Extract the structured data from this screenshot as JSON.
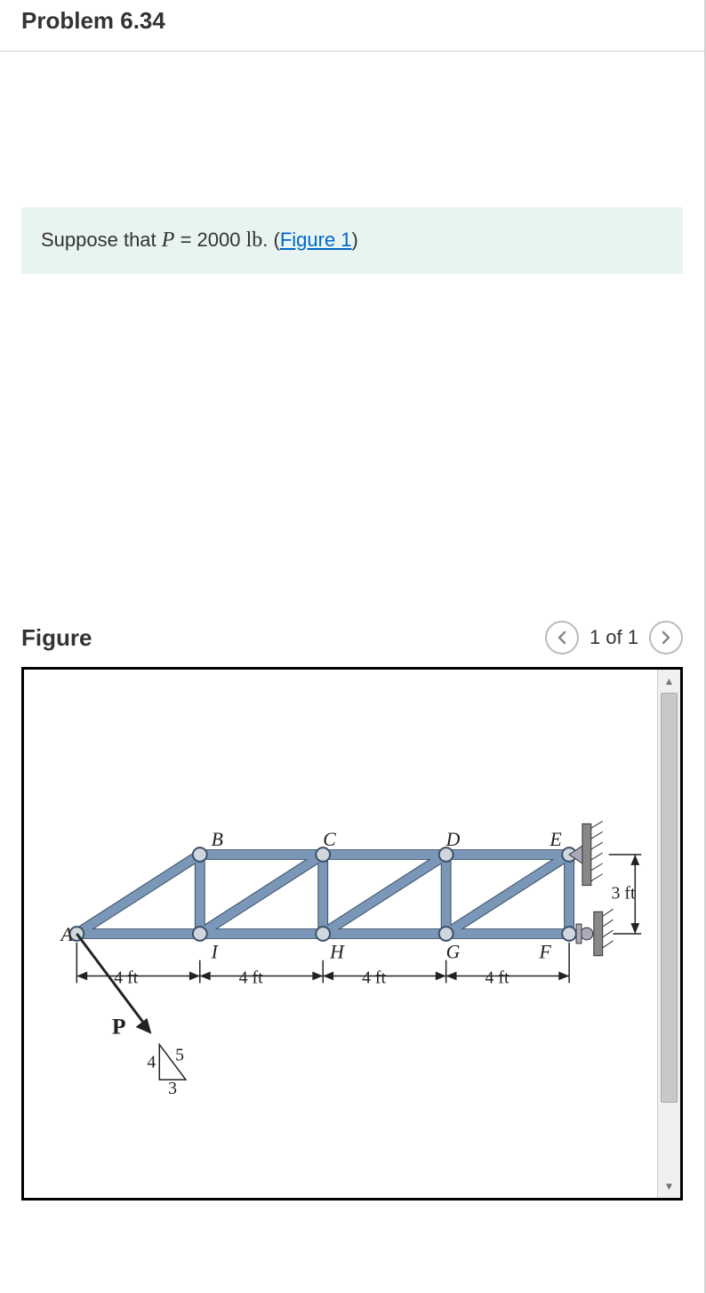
{
  "header": {
    "title": "Problem 6.34"
  },
  "instruction": {
    "prefix": "Suppose that ",
    "var": "P",
    "eq": " = 2000 ",
    "unit": "lb",
    "suffix": ". (",
    "link": "Figure 1",
    "close": ")"
  },
  "figure": {
    "label": "Figure",
    "nav_count": "1 of 1"
  },
  "truss": {
    "joints": {
      "A": "A",
      "B": "B",
      "C": "C",
      "D": "D",
      "E": "E",
      "F": "F",
      "G": "G",
      "H": "H",
      "I": "I"
    },
    "force": "P",
    "triangle": {
      "h": "5",
      "b": "3",
      "a": "4"
    },
    "dims": {
      "span": "4 ft",
      "height": "3 ft"
    }
  }
}
